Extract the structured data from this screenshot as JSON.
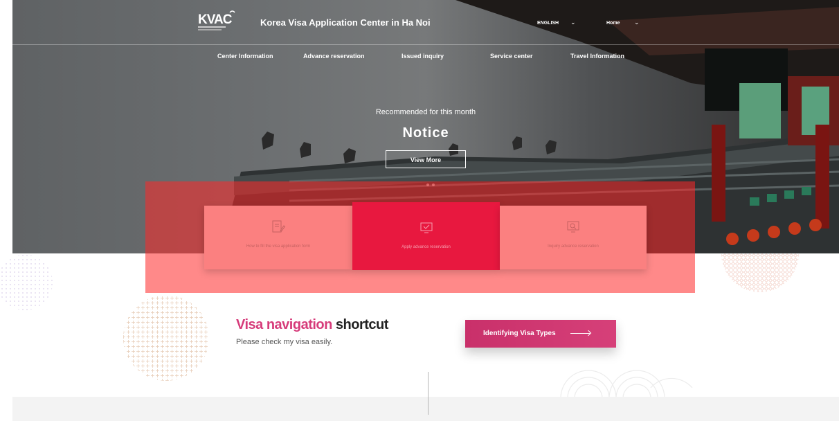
{
  "header": {
    "logo_text": "KVAC",
    "site_title": "Korea Visa Application Center in Ha Noi",
    "language": "ENGLISH",
    "home": "Home"
  },
  "nav": {
    "items": [
      {
        "label": "Center Information"
      },
      {
        "label": "Advance reservation"
      },
      {
        "label": "Issued inquiry"
      },
      {
        "label": "Service center"
      },
      {
        "label": "Travel Information"
      }
    ]
  },
  "hero": {
    "recommended": "Recommended for this month",
    "title": "Notice",
    "view_more": "View More"
  },
  "cards": [
    {
      "label": "How to fill the visa application form",
      "icon": "document-pen-icon"
    },
    {
      "label": "Apply advance reservation",
      "icon": "monitor-check-icon"
    },
    {
      "label": "Inquiry advance reservation",
      "icon": "monitor-search-icon"
    }
  ],
  "visa": {
    "title_highlight": "Visa navigation",
    "title_rest": " shortcut",
    "subtitle": "Please check my visa easily.",
    "button_label": "Identifying Visa Types"
  },
  "colors": {
    "accent_pink": "#d63b7a",
    "card_red": "#e8183f",
    "card_salmon": "#fb8080",
    "highlight": "#ff2828"
  }
}
